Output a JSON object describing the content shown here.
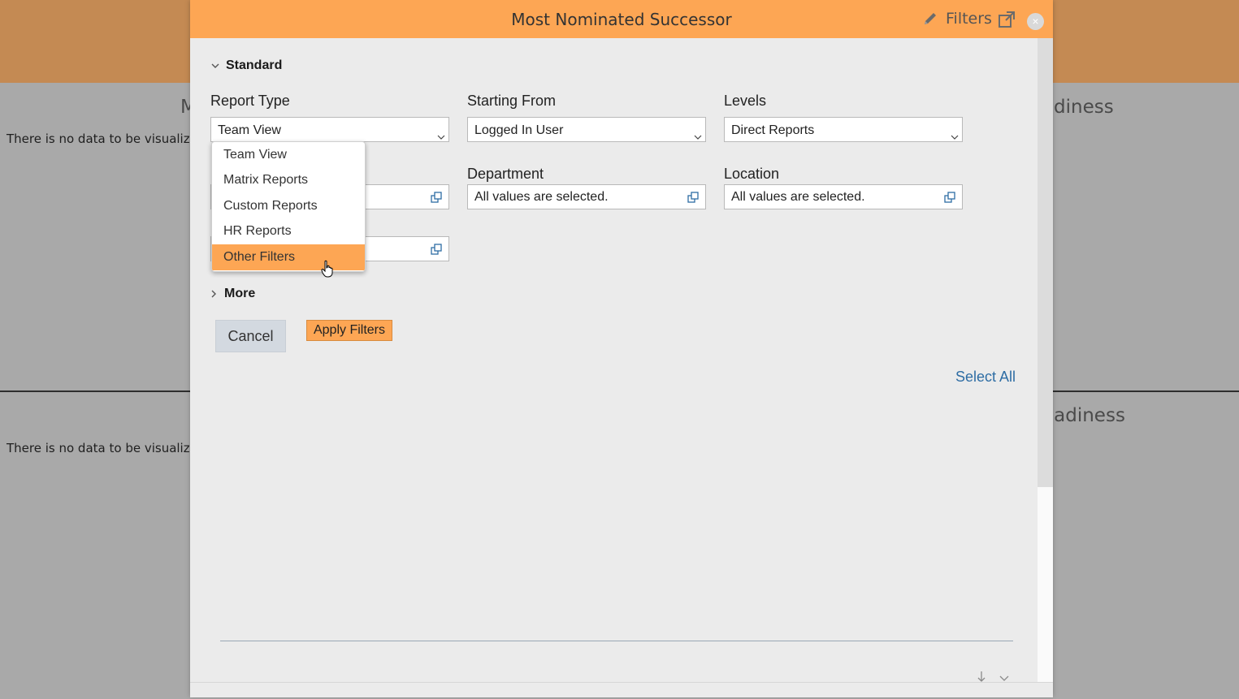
{
  "background": {
    "panel_top": {
      "title_left_fragment": "M",
      "title_right_fragment": "diness",
      "no_data": "There is no data to be visualized."
    },
    "panel_bottom": {
      "title_right_fragment": "eadiness",
      "no_data": "There is no data to be visualized."
    }
  },
  "modal": {
    "title": "Most Nominated Successor",
    "filters_label": "Filters",
    "close_label": "×",
    "sections": {
      "standard": "Standard",
      "more": "More"
    },
    "fields": {
      "report_type": {
        "label": "Report Type",
        "value": "Team View"
      },
      "starting_from": {
        "label": "Starting From",
        "value": "Logged In User"
      },
      "levels": {
        "label": "Levels",
        "value": "Direct Reports"
      },
      "department": {
        "label": "Department",
        "value": "All values are selected."
      },
      "location": {
        "label": "Location",
        "value": "All values are selected."
      }
    },
    "dropdown": {
      "options": [
        "Team View",
        "Matrix Reports",
        "Custom Reports",
        "HR Reports",
        "Other Filters"
      ],
      "highlighted": "Other Filters"
    },
    "buttons": {
      "cancel": "Cancel",
      "apply": "Apply Filters",
      "select_all": "Select All"
    }
  },
  "colors": {
    "accent": "#fda654",
    "link": "#2e6da4",
    "overlay_bg": "#a9a9a9"
  }
}
